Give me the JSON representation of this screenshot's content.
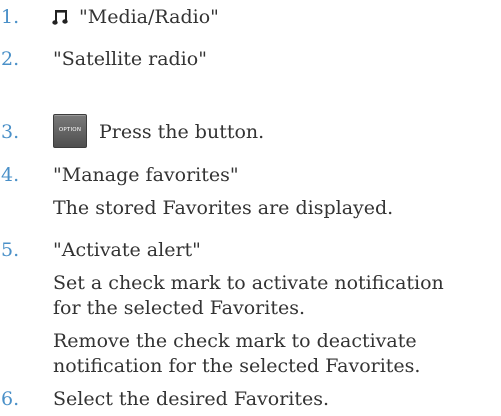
{
  "steps": [
    {
      "num": "1.",
      "text": "\"Media/Radio\"",
      "icon": "music-note-icon"
    },
    {
      "num": "2.",
      "text": "\"Satellite radio\""
    },
    {
      "num": "3.",
      "text": "Press the button.",
      "button_label": "OPTION"
    },
    {
      "num": "4.",
      "text": "\"Manage favorites\"",
      "result": "The stored Favorites are displayed."
    },
    {
      "num": "5.",
      "text": "\"Activate alert\"",
      "details": [
        [
          "Set a check mark to activate notification",
          "for the selected Favorites."
        ],
        [
          "Remove the check mark to deactivate",
          "notification for the selected Favorites."
        ]
      ]
    },
    {
      "num": "6.",
      "text": "Select the desired Favorites."
    }
  ],
  "colors": {
    "number": "#4a90c8",
    "text": "#333333",
    "button": "#5f5f5f"
  }
}
